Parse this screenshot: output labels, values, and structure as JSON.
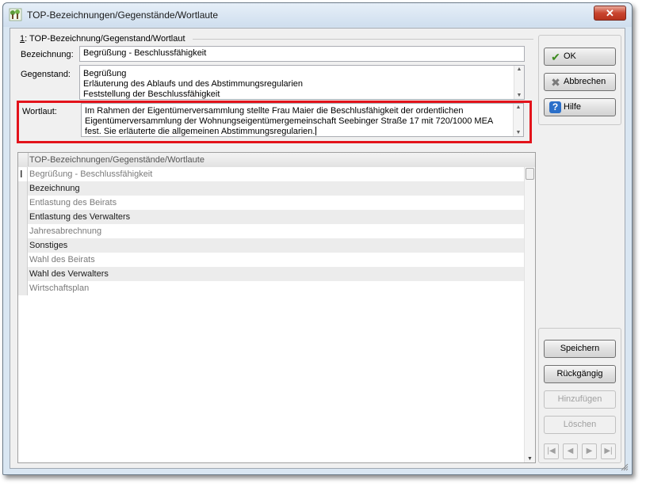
{
  "window": {
    "title": "TOP-Bezeichnungen/Gegenstände/Wortlaute",
    "close_icon": "close-icon"
  },
  "group": {
    "number": "1",
    "label": ": TOP-Bezeichnung/Gegenstand/Wortlaut"
  },
  "form": {
    "bezeichnung_label": "Bezeichnung:",
    "bezeichnung_value": "Begrüßung - Beschlussfähigkeit",
    "gegenstand_label": "Gegenstand:",
    "gegenstand_lines": [
      "Begrüßung",
      "Erläuterung des Ablaufs und des Abstimmungsregularien",
      "Feststellung der Beschlussfähigkeit"
    ],
    "wortlaut_label": "Wortlaut:",
    "wortlaut_lines": [
      "Im Rahmen der Eigentümerversammlung stellte Frau Maier die Beschlusfähigkeit der ordentlichen",
      "Eigentümerversammlung der Wohnungseigentümergemeinschaft Seebinger Straße 17 mit 720/1000 MEA",
      "fest. Sie erläuterte die allgemeinen Abstimmungsregularien."
    ]
  },
  "buttons": {
    "ok": "OK",
    "abbrechen": "Abbrechen",
    "hilfe": "Hilfe",
    "speichern": "Speichern",
    "rueckgaengig": "Rückgängig",
    "hinzufuegen": "Hinzufügen",
    "loeschen": "Löschen"
  },
  "grid": {
    "header": "TOP-Bezeichnungen/Gegenstände/Wortlaute",
    "rows": [
      "Begrüßung - Beschlussfähigkeit",
      "Bezeichnung",
      "Entlastung des Beirats",
      "Entlastung des Verwalters",
      "Jahresabrechnung",
      "Sonstiges",
      "Wahl des Beirats",
      "Wahl des Verwalters",
      "Wirtschaftsplan"
    ]
  },
  "navigation": {
    "first": "|◀",
    "prev": "◀",
    "next": "▶",
    "last": "▶|"
  },
  "colors": {
    "highlight_border": "#e3131b",
    "title_bar": "#dbe7f3",
    "close_button": "#c9452f"
  }
}
